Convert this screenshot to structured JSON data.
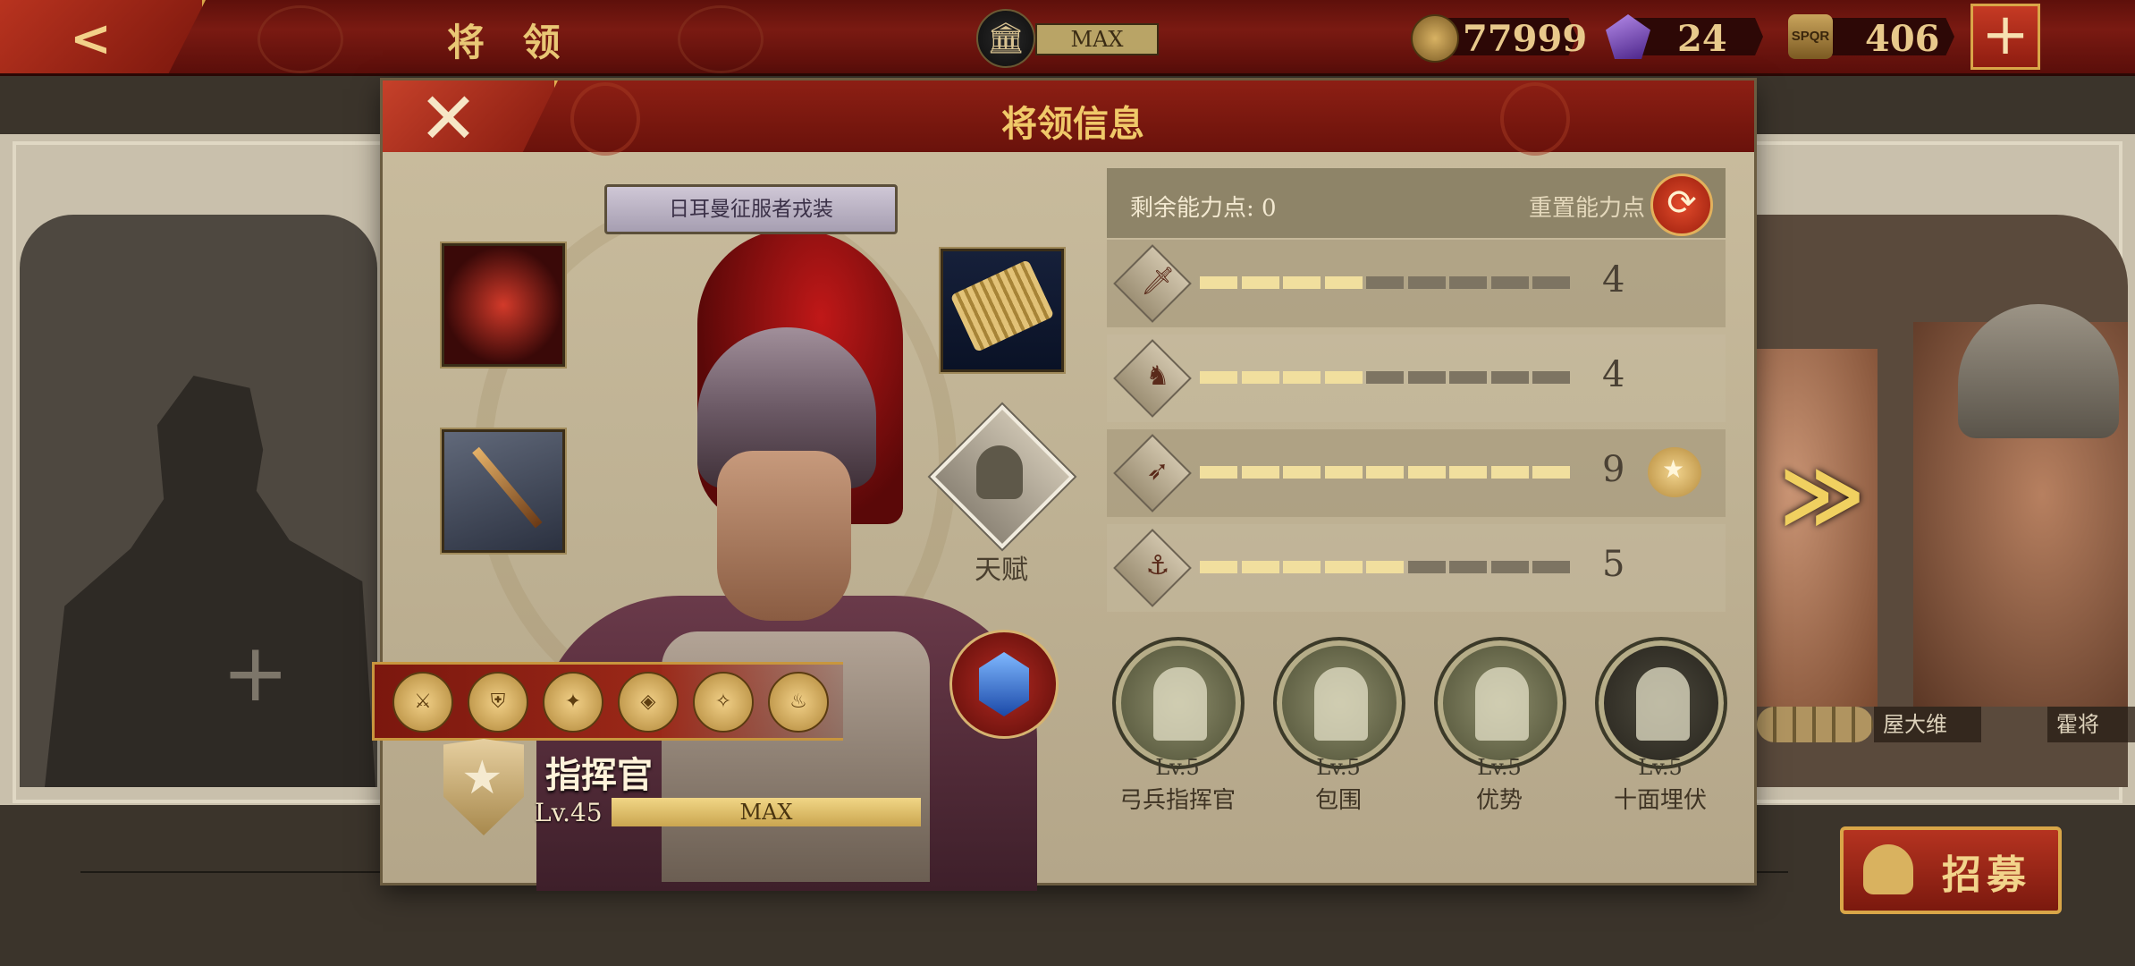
{
  "topbar": {
    "title": "将 领",
    "building_level": "MAX",
    "resources": {
      "coins": "77999",
      "gems": "24",
      "spqr": "406"
    },
    "spqr_icon_text": "SPQR",
    "plus_label": "+"
  },
  "dialog": {
    "title": "将领信息",
    "close_glyph": "✕",
    "skin_name": "日耳曼征服者戎装",
    "talent_label": "天赋",
    "commander": {
      "rank": "指挥官",
      "level": "Lv.45",
      "level_status": "MAX"
    },
    "stats": {
      "remaining_label": "剩余能力点: 0",
      "reset_label": "重置能力点",
      "rows": [
        {
          "icon": "sword-icon",
          "value": "4",
          "filled": 4,
          "total": 9
        },
        {
          "icon": "horse-icon",
          "value": "4",
          "filled": 4,
          "total": 9
        },
        {
          "icon": "bow-icon",
          "value": "9",
          "filled": 9,
          "total": 9,
          "medal": true
        },
        {
          "icon": "anchor-icon",
          "value": "5",
          "filled": 5,
          "total": 9
        }
      ]
    },
    "skills": [
      {
        "level": "Lv.5",
        "name": "弓兵指挥官"
      },
      {
        "level": "Lv.5",
        "name": "包围"
      },
      {
        "level": "Lv.5",
        "name": "优势"
      },
      {
        "level": "Lv.5",
        "name": "十面埋伏"
      }
    ]
  },
  "gallery": {
    "slot_plus": "+",
    "next_arrow": "≫",
    "right_names": [
      "屋大维",
      "霍将"
    ],
    "recruit_label": "招募"
  },
  "colors": {
    "accent_red": "#7a1a12",
    "gold": "#e9c775",
    "stat_filled": "#f1df9e",
    "stat_empty": "#7d7462"
  }
}
